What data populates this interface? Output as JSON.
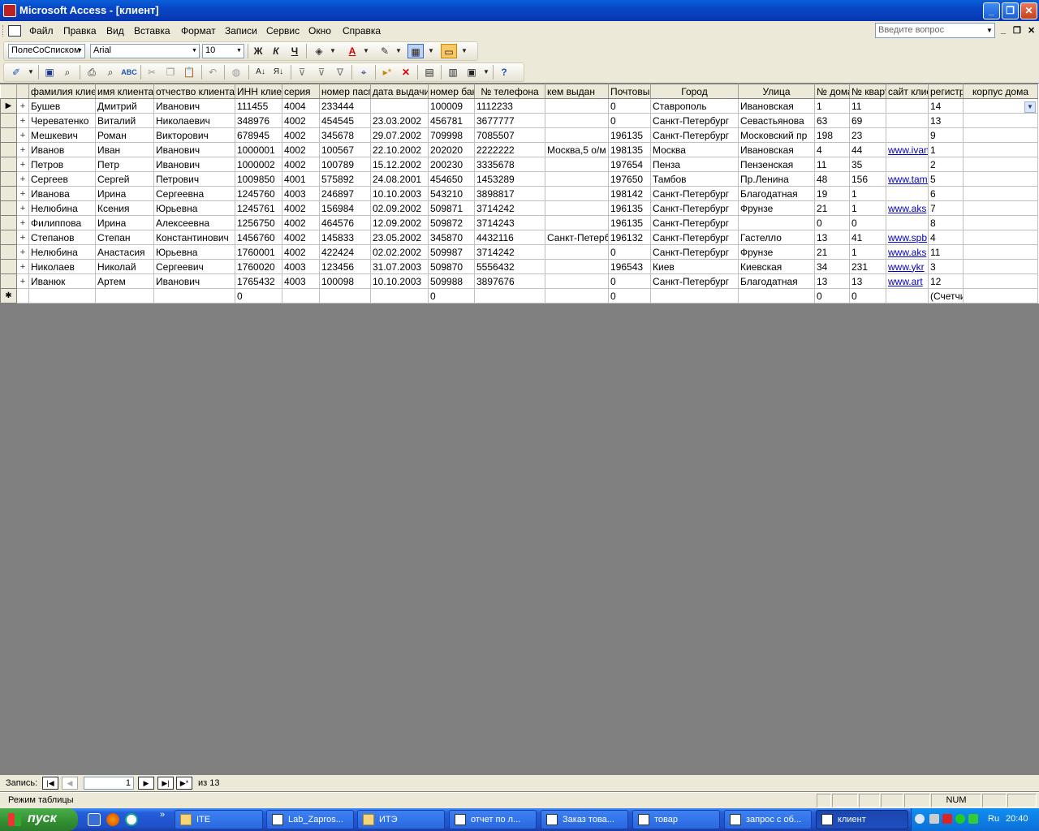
{
  "window": {
    "title": "Microsoft Access - [клиент]"
  },
  "menu": {
    "items": [
      "Файл",
      "Правка",
      "Вид",
      "Вставка",
      "Формат",
      "Записи",
      "Сервис",
      "Окно",
      "Справка"
    ],
    "help_placeholder": "Введите вопрос"
  },
  "format_toolbar": {
    "object_combo": "ПолеСоСписком",
    "font": "Arial",
    "size": "10",
    "bold": "Ж",
    "italic": "К",
    "underline": "Ч"
  },
  "columns": [
    "фамилия клиента",
    "имя клиента",
    "отчество клиента",
    "ИНН клиента",
    "серия",
    "номер паспорта",
    "дата выдачи",
    "номер банка",
    "№ телефона",
    "кем выдан",
    "Почтовый",
    "Город",
    "Улица",
    "№ дома",
    "№ квартиры",
    "сайт клиента",
    "регистр",
    "корпус дома"
  ],
  "rows": [
    [
      "Бушев",
      "Дмитрий",
      "Иванович",
      "111455",
      "4004",
      "233444",
      "",
      "100009",
      "1112233",
      "",
      "0",
      "Ставрополь",
      "Ивановская",
      "1",
      "11",
      "",
      "14",
      ""
    ],
    [
      "Череватенко",
      "Виталий",
      "Николаевич",
      "348976",
      "4002",
      "454545",
      "23.03.2002",
      "456781",
      "3677777",
      "",
      "0",
      "Санкт-Петербург",
      "Севастьянова",
      "63",
      "69",
      "",
      "13",
      ""
    ],
    [
      "Мешкевич",
      "Роман",
      "Викторович",
      "678945",
      "4002",
      "345678",
      "29.07.2002",
      "709998",
      "7085507",
      "",
      "196135",
      "Санкт-Петербург",
      "Московский пр",
      "198",
      "23",
      "",
      "9",
      ""
    ],
    [
      "Иванов",
      "Иван",
      "Иванович",
      "1000001",
      "4002",
      "100567",
      "22.10.2002",
      "202020",
      "2222222",
      "Москва,5 о/м",
      "198135",
      "Москва",
      "Ивановская",
      "4",
      "44",
      "www.ivanov",
      "1",
      ""
    ],
    [
      "Петров",
      "Петр",
      "Иванович",
      "1000002",
      "4002",
      "100789",
      "15.12.2002",
      "200230",
      "3335678",
      "",
      "197654",
      "Пенза",
      "Пензенская",
      "11",
      "35",
      "",
      "2",
      ""
    ],
    [
      "Сергеев",
      "Сергей",
      "Петрович",
      "1009850",
      "4001",
      "575892",
      "24.08.2001",
      "454650",
      "1453289",
      "",
      "197650",
      "Тамбов",
      "Пр.Ленина",
      "48",
      "156",
      "www.tambov",
      "5",
      ""
    ],
    [
      "Иванова",
      "Ирина",
      "Сергеевна",
      "1245760",
      "4003",
      "246897",
      "10.10.2003",
      "543210",
      "3898817",
      "",
      "198142",
      "Санкт-Петербург",
      "Благодатная",
      "19",
      "1",
      "",
      "6",
      ""
    ],
    [
      "Нелюбина",
      "Ксения",
      "Юрьевна",
      "1245761",
      "4002",
      "156984",
      "02.09.2002",
      "509871",
      "3714242",
      "",
      "196135",
      "Санкт-Петербург",
      "Фрунзе",
      "21",
      "1",
      "www.aks",
      "7",
      ""
    ],
    [
      "Филиппова",
      "Ирина",
      "Алексеевна",
      "1256750",
      "4002",
      "464576",
      "12.09.2002",
      "509872",
      "3714243",
      "",
      "196135",
      "Санкт-Петербург",
      "",
      "0",
      "0",
      "",
      "8",
      ""
    ],
    [
      "Степанов",
      "Степан",
      "Константинович",
      "1456760",
      "4002",
      "145833",
      "23.05.2002",
      "345870",
      "4432116",
      "Санкт-Петербург",
      "196132",
      "Санкт-Петербург",
      "Гастелло",
      "13",
      "41",
      "www.spb",
      "4",
      ""
    ],
    [
      "Нелюбина",
      "Анастасия",
      "Юрьевна",
      "1760001",
      "4002",
      "422424",
      "02.02.2002",
      "509987",
      "3714242",
      "",
      "0",
      "Санкт-Петербург",
      "Фрунзе",
      "21",
      "1",
      "www.aks",
      "11",
      ""
    ],
    [
      "Николаев",
      "Николай",
      "Сергеевич",
      "1760020",
      "4003",
      "123456",
      "31.07.2003",
      "509870",
      "5556432",
      "",
      "196543",
      "Киев",
      "Киевская",
      "34",
      "231",
      "www.ykr",
      "3",
      ""
    ],
    [
      "Иванюк",
      "Артем",
      "Иванович",
      "1765432",
      "4003",
      "100098",
      "10.10.2003",
      "509988",
      "3897676",
      "",
      "0",
      "Санкт-Петербург",
      "Благодатная",
      "13",
      "13",
      "www.art",
      "12",
      ""
    ]
  ],
  "new_row": [
    "",
    "",
    "",
    "0",
    "",
    "",
    "",
    "0",
    "",
    "",
    "0",
    "",
    "",
    "0",
    "0",
    "",
    "(Счетчик)",
    ""
  ],
  "record_nav": {
    "label": "Запись:",
    "current": "1",
    "of_text": "из 13"
  },
  "status": {
    "mode": "Режим таблицы",
    "num": "NUM"
  },
  "taskbar": {
    "start": "пуск",
    "tasks": [
      "ITE",
      "Lab_Zapros...",
      "ИТЭ",
      "отчет по л...",
      "Заказ това...",
      "товар",
      "запрос с об...",
      "клиент"
    ],
    "lang": "Ru",
    "clock": "20:40"
  },
  "colors": {
    "titlebar": "#0846c5",
    "chrome": "#ece9d8",
    "workspace": "#808080",
    "link": "#0000cc"
  }
}
